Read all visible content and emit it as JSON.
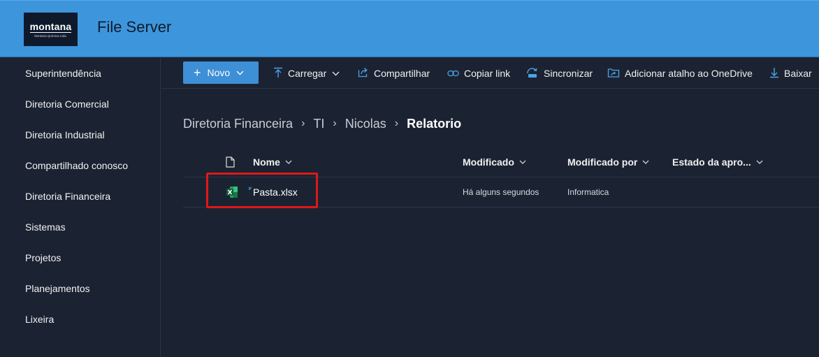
{
  "header": {
    "logo_word": "montana",
    "logo_sub": "Montana Química Ltda.",
    "title": "File Server",
    "color": "#3d96dc"
  },
  "sidebar": {
    "items": [
      {
        "label": "Superintendência"
      },
      {
        "label": "Diretoria Comercial"
      },
      {
        "label": "Diretoria Industrial"
      },
      {
        "label": "Compartilhado conosco"
      },
      {
        "label": "Diretoria Financeira"
      },
      {
        "label": "Sistemas"
      },
      {
        "label": "Projetos"
      },
      {
        "label": "Planejamentos"
      },
      {
        "label": "Lixeira"
      }
    ]
  },
  "toolbar": {
    "new_label": "Novo",
    "upload_label": "Carregar",
    "share_label": "Compartilhar",
    "copy_link_label": "Copiar link",
    "sync_label": "Sincronizar",
    "onedrive_label": "Adicionar atalho ao OneDrive",
    "download_label": "Baixar",
    "accent": "#3d8fd6"
  },
  "breadcrumb": {
    "items": [
      "Diretoria Financeira",
      "TI",
      "Nicolas"
    ],
    "current": "Relatorio"
  },
  "list": {
    "columns": {
      "name": "Nome",
      "modified": "Modificado",
      "modified_by": "Modificado por",
      "approval": "Estado da apro..."
    },
    "rows": [
      {
        "icon": "excel-file-icon",
        "name": "Pasta.xlsx",
        "modified": "Há alguns segundos",
        "modified_by": "Informatica",
        "approval": ""
      }
    ]
  },
  "highlight_color": "#e01818"
}
